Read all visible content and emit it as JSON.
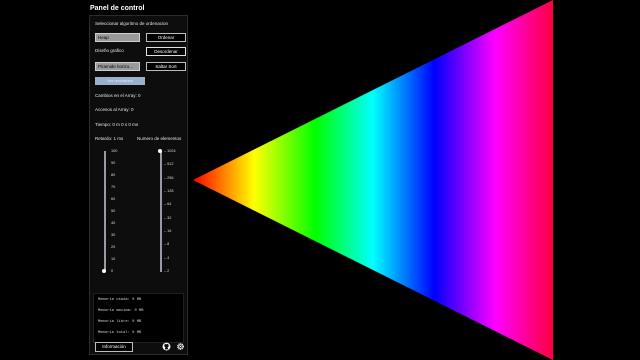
{
  "panel": {
    "title": "Panel de control",
    "algorithm_section_label": "Seleccionar algoritmo de ordenacion",
    "algorithm_select_value": "Heap",
    "sort_button": "Ordenar",
    "design_label": "Diseño grafico",
    "shuffle_button": "Desordenar",
    "design_select_value": "Piramide horizo...",
    "skip_sort_button": "Saltar Sort",
    "view_details_button": "Ver resultados",
    "stats": {
      "changes": "Cambios en el Array: 0",
      "accesses": "Accesos al Array: 0",
      "time": "Tiempo: 0 m 0 s 0 ms"
    },
    "delay": {
      "label": "Retardo: 1 ms",
      "ticks": [
        "100",
        "90",
        "80",
        "70",
        "60",
        "50",
        "40",
        "30",
        "20",
        "10",
        "0"
      ],
      "value_fraction": 0.0
    },
    "elements": {
      "label": "Numero de elementos",
      "ticks": [
        "1024",
        "512",
        "256",
        "128",
        "64",
        "32",
        "16",
        "8",
        "4",
        "2"
      ],
      "value": "1024"
    },
    "memory": {
      "used": "Memoria usada: 0 MB",
      "max": "Memoria maxima: 0 MB",
      "free": "Memoria libre: 0 MB",
      "total": "Memoria total: 0 MB"
    },
    "info_button": "Información",
    "icons": [
      "github-icon",
      "gear-icon"
    ]
  },
  "visualization": {
    "design": "horizontal pyramid",
    "gradient": "hue spectrum red to magenta"
  }
}
